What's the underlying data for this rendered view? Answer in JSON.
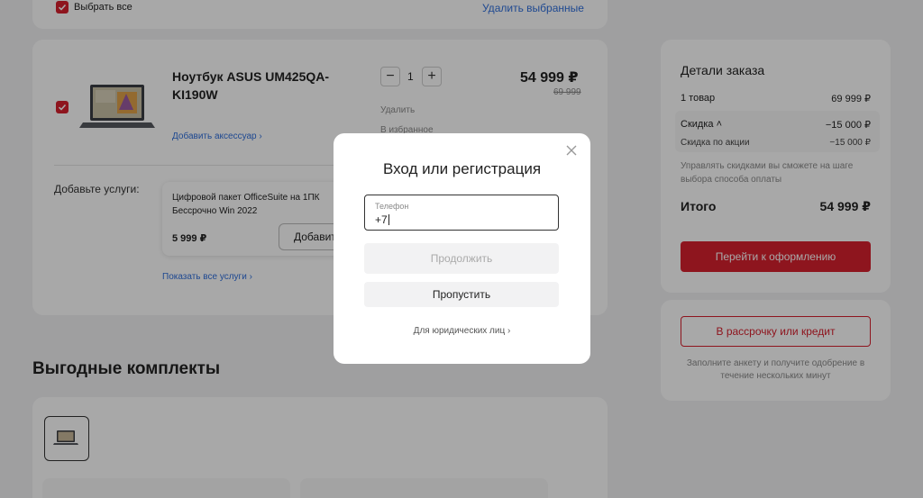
{
  "cart": {
    "select_all_label": "Выбрать все",
    "delete_selected_label": "Удалить выбранные",
    "item": {
      "title_line1": "Ноутбук ASUS UM425QA-",
      "title_line2": "KI190W",
      "add_accessory_label": "Добавить аксессуар",
      "quantity": "1",
      "price": "54 999 ₽",
      "old_price": "69 999",
      "delete_label": "Удалить",
      "favorite_label": "В избранное"
    },
    "services": {
      "heading": "Добавьте услуги:",
      "service_name_line1": "Цифровой пакет OfficeSuite на 1ПК",
      "service_name_line2": "Бессрочно Win 2022",
      "service_price": "5 999 ₽",
      "add_label": "Добавить",
      "show_all_label": "Показать все услуги"
    },
    "bundles_heading": "Выгодные комплекты",
    "bundle_card_1_title": "",
    "bundle_card_2_title": ""
  },
  "summary": {
    "title": "Детали заказа",
    "items_label": "1 товар",
    "items_value": "69 999 ₽",
    "discount_label": "Скидка",
    "discount_value": "−15 000 ₽",
    "promo_label": "Скидка по акции",
    "promo_value": "−15 000 ₽",
    "note": "Управлять скидками вы сможете на шаге выбора способа оплаты",
    "total_label": "Итого",
    "total_value": "54 999 ₽",
    "checkout_label": "Перейти к оформлению",
    "credit_label": "В рассрочку или кредит",
    "credit_note": "Заполните анкету и получите одобрение в течение нескольких минут"
  },
  "modal": {
    "title": "Вход или регистрация",
    "phone_label": "Телефон",
    "phone_value": "+7",
    "continue_label": "Продолжить",
    "skip_label": "Пропустить",
    "legal_label": "Для юридических лиц"
  },
  "colors": {
    "accent": "#d8202e",
    "link": "#2f6fdc",
    "background": "#f2f2f3"
  }
}
